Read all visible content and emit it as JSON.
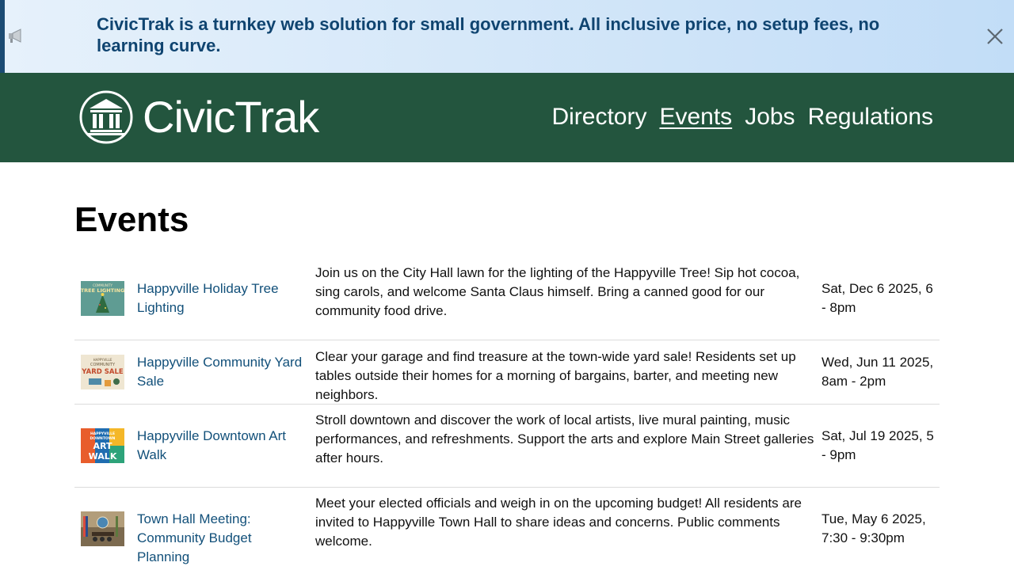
{
  "banner": {
    "text": "CivicTrak is a turnkey web solution for small government. All inclusive price, no setup fees, no learning curve.",
    "icon": "megaphone-icon",
    "close_icon": "close-icon"
  },
  "header": {
    "brand": "CivicTrak",
    "logo_icon": "city-hall-icon",
    "nav": [
      {
        "label": "Directory",
        "active": false
      },
      {
        "label": "Events",
        "active": true
      },
      {
        "label": "Jobs",
        "active": false
      },
      {
        "label": "Regulations",
        "active": false
      }
    ]
  },
  "main": {
    "title": "Events",
    "events": [
      {
        "name": "Happyville Holiday Tree Lighting",
        "description": "Join us on the City Hall lawn for the lighting of the Happyville Tree! Sip hot cocoa, sing carols, and welcome Santa Claus himself. Bring a canned good for our community food drive.",
        "date": "Sat, Dec 6 2025, 6 - 8pm",
        "thumb_text": [
          "COMMUNITY",
          "TREE LIGHTING"
        ]
      },
      {
        "name": "Happyville Community Yard Sale",
        "description": "Clear your garage and find treasure at the town-wide yard sale! Residents set up tables outside their homes for a morning of bargains, barter, and meeting new neighbors.",
        "date": "Wed, Jun 11 2025, 8am - 2pm",
        "thumb_text": [
          "HAPPYVILLE",
          "COMMUNITY",
          "YARD SALE"
        ]
      },
      {
        "name": "Happyville Downtown Art Walk",
        "description": "Stroll downtown and discover the work of local artists, live mural painting, music performances, and refreshments. Support the arts and explore Main Street galleries after hours.",
        "date": "Sat, Jul 19 2025, 5 - 9pm",
        "thumb_text": [
          "HAPPYVILLE",
          "DOWNTOWN",
          "ART",
          "WALK"
        ]
      },
      {
        "name": "Town Hall Meeting: Community Budget Planning",
        "description": "Meet your elected officials and weigh in on the upcoming budget! All residents are invited to Happyville Town Hall to share ideas and concerns. Public comments welcome.",
        "date": "Tue, May 6 2025, 7:30 - 9:30pm",
        "thumb_text": []
      }
    ]
  }
}
